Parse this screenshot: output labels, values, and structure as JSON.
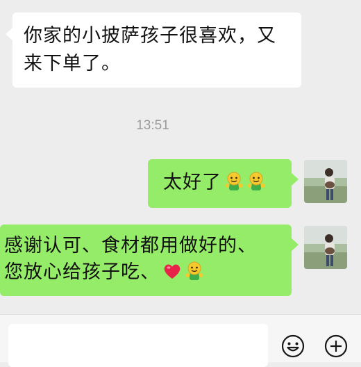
{
  "chat": {
    "incoming_message": "你家的小披萨孩子很喜欢，又来下单了。",
    "timestamp": "13:51",
    "outgoing_1": {
      "text": "太好了",
      "emojis": [
        "smile-face-emoji",
        "smile-face-emoji"
      ]
    },
    "outgoing_2": {
      "line1": "感谢认可、食材都用做好的、",
      "line2": "您放心给孩子吃、",
      "emojis": [
        "red-heart-emoji",
        "smile-face-emoji"
      ]
    }
  },
  "input": {
    "value": "",
    "placeholder": ""
  },
  "icons": {
    "emoji_button": "smiley-icon",
    "add_button": "plus-circle-icon"
  },
  "colors": {
    "background": "#ededed",
    "incoming_bubble": "#ffffff",
    "outgoing_bubble": "#95ec69"
  }
}
